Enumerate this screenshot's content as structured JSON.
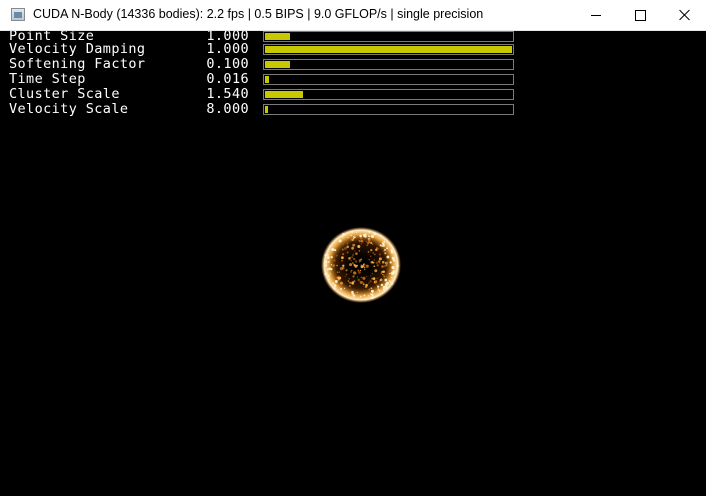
{
  "window": {
    "title": "CUDA N-Body (14336 bodies): 2.2 fps | 0.5 BIPS | 9.0 GFLOP/s | single precision",
    "icon": "app-window-icon",
    "controls": {
      "minimize": "minimize-icon",
      "maximize": "maximize-icon",
      "close": "close-icon"
    }
  },
  "params": [
    {
      "name": "Point Size",
      "value": "1.000",
      "fraction": 0.1
    },
    {
      "name": "Velocity Damping",
      "value": "1.000",
      "fraction": 1.0
    },
    {
      "name": "Softening Factor",
      "value": "0.100",
      "fraction": 0.1
    },
    {
      "name": "Time Step",
      "value": "0.016",
      "fraction": 0.016
    },
    {
      "name": "Cluster Scale",
      "value": "1.540",
      "fraction": 0.154
    },
    {
      "name": "Velocity Scale",
      "value": "8.000",
      "fraction": 0.008
    }
  ],
  "colors": {
    "slider_fill": "#c8c800",
    "slider_border": "#7a7a7a",
    "background": "#000000",
    "particles": "#ffcf80"
  }
}
